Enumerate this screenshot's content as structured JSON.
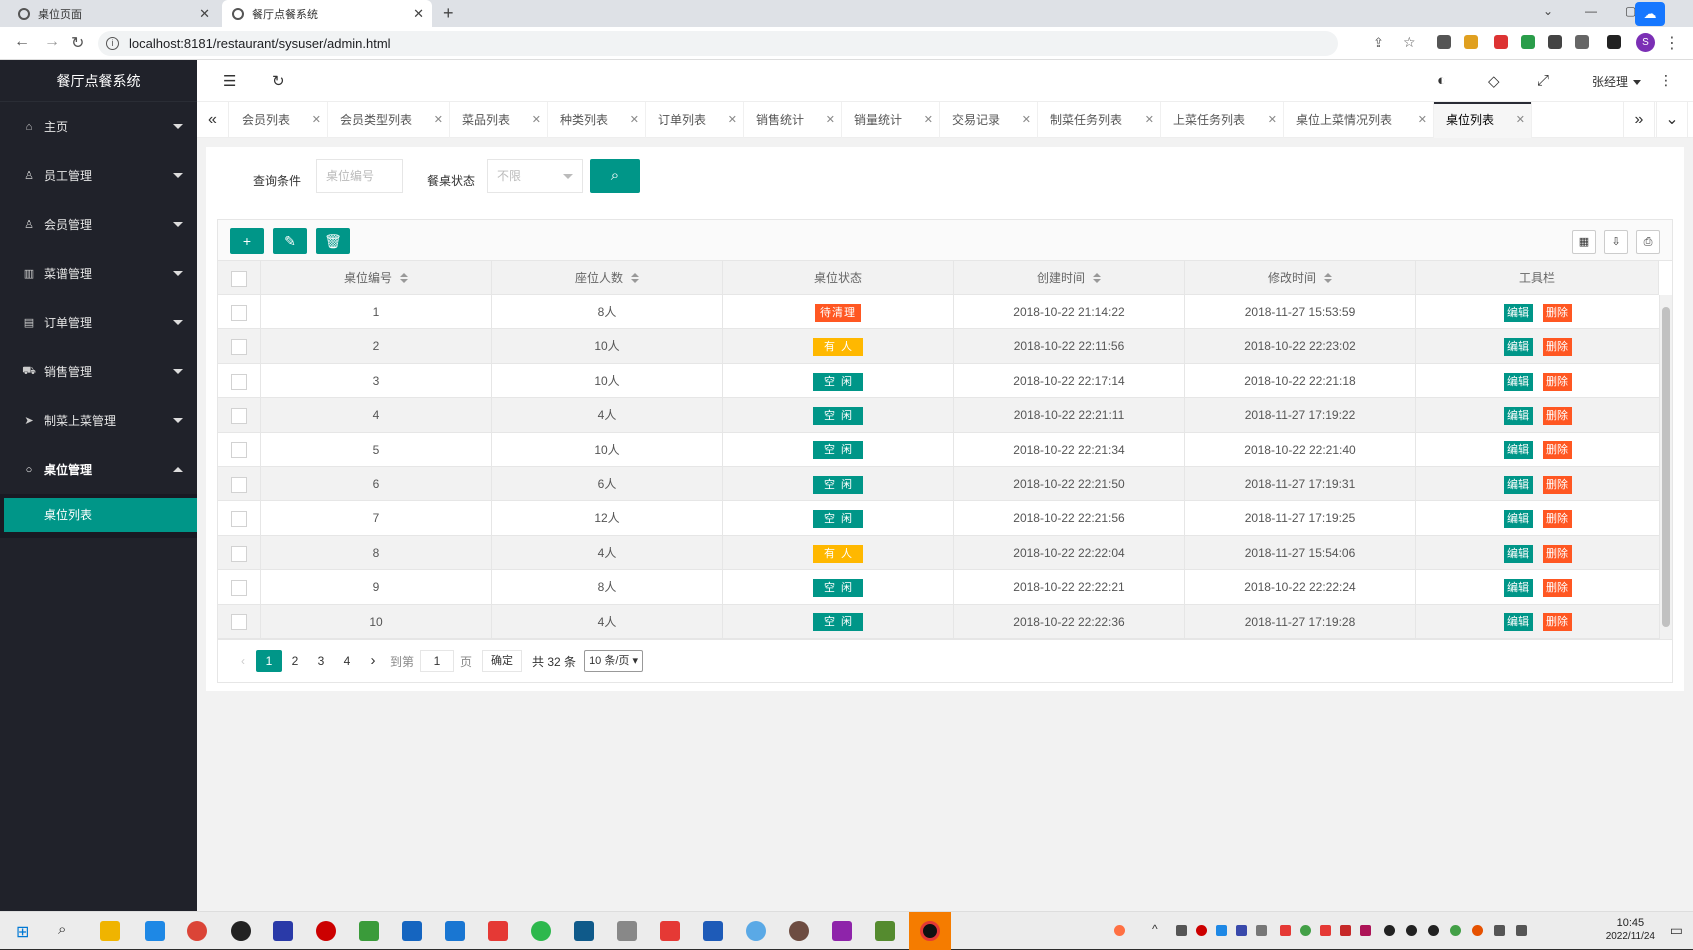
{
  "browser": {
    "tabs": [
      {
        "title": "桌位页面"
      },
      {
        "title": "餐厅点餐系统"
      }
    ],
    "url": "localhost:8181/restaurant/sysuser/admin.html",
    "avatar_letter": "S"
  },
  "app": {
    "title": "餐厅点餐系统",
    "user": "张经理"
  },
  "sidebar": {
    "items": [
      {
        "label": "主页",
        "icon": "home-icon",
        "glyph": "⌂"
      },
      {
        "label": "员工管理",
        "icon": "staff-icon",
        "glyph": "♙"
      },
      {
        "label": "会员管理",
        "icon": "member-icon",
        "glyph": "♙"
      },
      {
        "label": "菜谱管理",
        "icon": "book-icon",
        "glyph": "▥"
      },
      {
        "label": "订单管理",
        "icon": "order-icon",
        "glyph": "▤"
      },
      {
        "label": "销售管理",
        "icon": "cart-icon",
        "glyph": "⛟"
      },
      {
        "label": "制菜上菜管理",
        "icon": "send-icon",
        "glyph": "➤"
      },
      {
        "label": "桌位管理",
        "icon": "circle-icon",
        "glyph": "○"
      }
    ],
    "sub_items": [
      {
        "label": "桌位列表"
      }
    ]
  },
  "page_tabs": [
    {
      "label": "会员列表"
    },
    {
      "label": "会员类型列表"
    },
    {
      "label": "菜品列表"
    },
    {
      "label": "种类列表"
    },
    {
      "label": "订单列表"
    },
    {
      "label": "销售统计"
    },
    {
      "label": "销量统计"
    },
    {
      "label": "交易记录"
    },
    {
      "label": "制菜任务列表"
    },
    {
      "label": "上菜任务列表"
    },
    {
      "label": "桌位上菜情况列表"
    },
    {
      "label": "桌位列表"
    }
  ],
  "search": {
    "label": "查询条件",
    "placeholder": "桌位编号",
    "status_label": "餐桌状态",
    "status_value": "不限"
  },
  "table": {
    "columns": [
      "桌位编号",
      "座位人数",
      "桌位状态",
      "创建时间",
      "修改时间",
      "工具栏"
    ],
    "edit_label": "编辑",
    "delete_label": "删除",
    "rows": [
      {
        "id": "1",
        "seats": "8人",
        "status": "待清理",
        "created": "2018-10-22 21:14:22",
        "modified": "2018-11-27 15:53:59"
      },
      {
        "id": "2",
        "seats": "10人",
        "status": "有人",
        "created": "2018-10-22 22:11:56",
        "modified": "2018-10-22 22:23:02"
      },
      {
        "id": "3",
        "seats": "10人",
        "status": "空闲",
        "created": "2018-10-22 22:17:14",
        "modified": "2018-10-22 22:21:18"
      },
      {
        "id": "4",
        "seats": "4人",
        "status": "空闲",
        "created": "2018-10-22 22:21:11",
        "modified": "2018-11-27 17:19:22"
      },
      {
        "id": "5",
        "seats": "10人",
        "status": "空闲",
        "created": "2018-10-22 22:21:34",
        "modified": "2018-10-22 22:21:40"
      },
      {
        "id": "6",
        "seats": "6人",
        "status": "空闲",
        "created": "2018-10-22 22:21:50",
        "modified": "2018-11-27 17:19:31"
      },
      {
        "id": "7",
        "seats": "12人",
        "status": "空闲",
        "created": "2018-10-22 22:21:56",
        "modified": "2018-11-27 17:19:25"
      },
      {
        "id": "8",
        "seats": "4人",
        "status": "有人",
        "created": "2018-10-22 22:22:04",
        "modified": "2018-11-27 15:54:06"
      },
      {
        "id": "9",
        "seats": "8人",
        "status": "空闲",
        "created": "2018-10-22 22:22:21",
        "modified": "2018-10-22 22:22:24"
      },
      {
        "id": "10",
        "seats": "4人",
        "status": "空闲",
        "created": "2018-10-22 22:22:36",
        "modified": "2018-11-27 17:19:28"
      }
    ]
  },
  "pager": {
    "pages": [
      "1",
      "2",
      "3",
      "4"
    ],
    "goto_label": "到第",
    "goto_value": "1",
    "page_unit": "页",
    "confirm": "确定",
    "total": "共 32 条",
    "per_page": "10 条/页"
  },
  "taskbar": {
    "time": "10:45",
    "date": "2022/11/24"
  },
  "colors": {
    "accent": "#009688",
    "danger": "#ff5722",
    "warn": "#ffb800",
    "sidebar": "#20222a"
  }
}
